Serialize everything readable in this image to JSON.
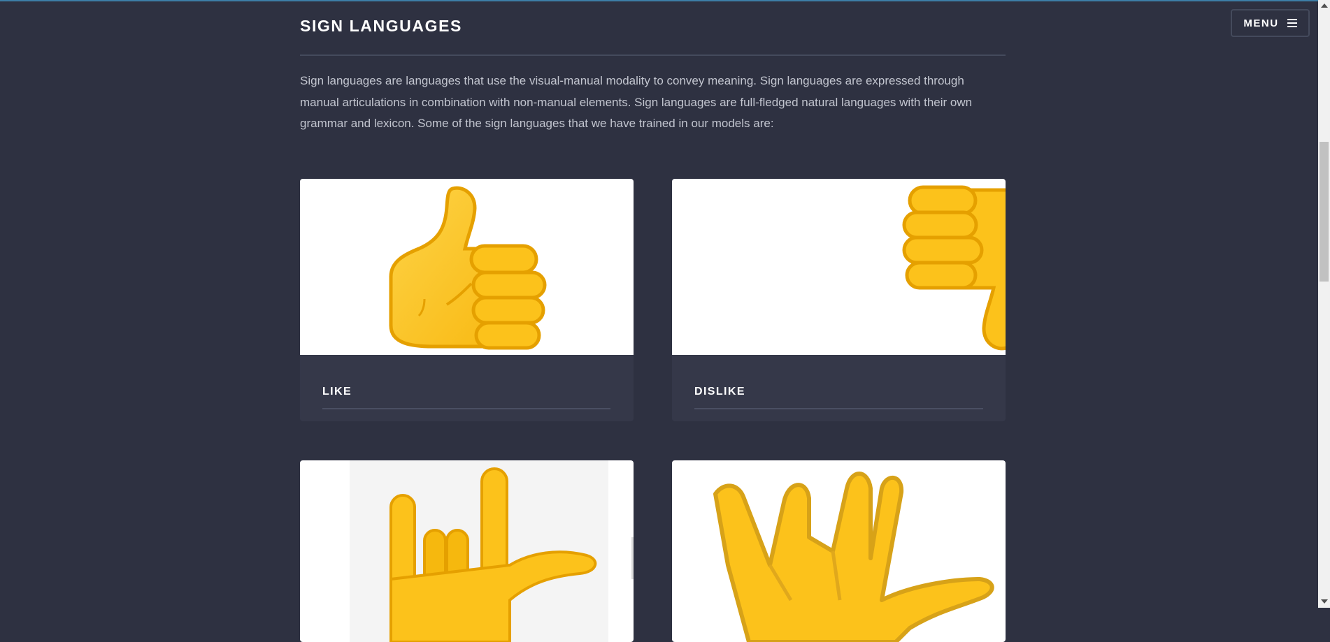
{
  "header": {
    "menu_label": "MENU",
    "menu_icon": "hamburger-icon"
  },
  "section": {
    "title": "SIGN LANGUAGES",
    "intro": "Sign languages are languages that use the visual-manual modality to convey meaning. Sign languages are expressed through manual articulations in combination with non-manual elements. Sign languages are full-fledged natural languages with their own grammar and lexicon. Some of the sign languages that we have trained in our models are:"
  },
  "cards": [
    {
      "label": "LIKE",
      "icon": "thumbs-up-icon"
    },
    {
      "label": "DISLIKE",
      "icon": "thumbs-down-icon"
    },
    {
      "label": "",
      "icon": "love-you-gesture-icon"
    },
    {
      "label": "",
      "icon": "vulcan-salute-icon"
    }
  ],
  "colors": {
    "background": "#2e3141",
    "card_background": "#353849",
    "emoji_yellow": "#fcc21b",
    "emoji_outline": "#e5a000"
  }
}
